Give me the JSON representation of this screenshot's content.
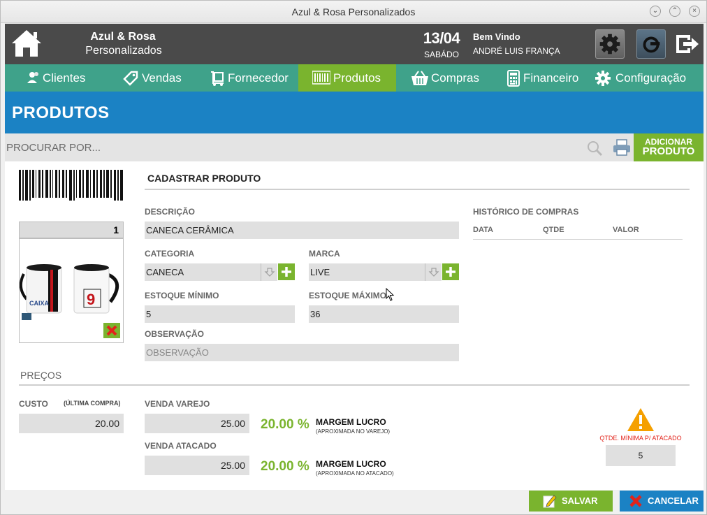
{
  "window": {
    "title": "Azul & Rosa Personalizados"
  },
  "header": {
    "brand_name": "Azul & Rosa",
    "brand_sub": "Personalizados",
    "date": "13/04",
    "weekday": "SABÁDO",
    "welcome": "Bem Vindo",
    "user": "ANDRÉ LUIS FRANÇA"
  },
  "nav": {
    "items": [
      {
        "label": "Clientes",
        "icon": "users-icon"
      },
      {
        "label": "Vendas",
        "icon": "tag-icon"
      },
      {
        "label": "Fornecedor",
        "icon": "supplier-icon"
      },
      {
        "label": "Produtos",
        "icon": "barcode-icon",
        "active": true
      },
      {
        "label": "Compras",
        "icon": "basket-icon"
      },
      {
        "label": "Financeiro",
        "icon": "calculator-icon"
      },
      {
        "label": "Configuração",
        "icon": "gear-icon"
      }
    ]
  },
  "page": {
    "title": "PRODUTOS"
  },
  "search": {
    "placeholder": "PROCURAR POR..."
  },
  "add_button": {
    "line1": "ADICIONAR",
    "line2": "PRODUTO"
  },
  "product": {
    "code": "1",
    "section_title": "CADASTRAR PRODUTO",
    "description_label": "DESCRIÇÃO",
    "description": "CANECA CERÂMICA",
    "category_label": "CATEGORIA",
    "category": "CANECA",
    "brand_label": "MARCA",
    "brand": "LIVE",
    "min_stock_label": "ESTOQUE MÍNIMO",
    "min_stock": "5",
    "max_stock_label": "ESTOQUE MÁXIMO",
    "max_stock": "36",
    "notes_label": "OBSERVAÇÃO",
    "notes_placeholder": "OBSERVAÇÃO"
  },
  "history": {
    "title": "HISTÓRICO DE COMPRAS",
    "columns": [
      "DATA",
      "QTDE",
      "VALOR"
    ]
  },
  "prices": {
    "title": "PREÇOS",
    "cost_label": "CUSTO",
    "cost_note": "(ÚLTIMA COMPRA)",
    "cost": "20.00",
    "retail_label": "VENDA VAREJO",
    "retail": "25.00",
    "retail_margin": "20.00 %",
    "retail_margin_title": "MARGEM LUCRO",
    "retail_margin_note": "(APROXIMADA NO VAREJO)",
    "wholesale_label": "VENDA ATACADO",
    "wholesale": "25.00",
    "wholesale_margin": "20.00 %",
    "wholesale_margin_title": "MARGEM LUCRO",
    "wholesale_margin_note": "(APROXIMADA NO ATACADO)",
    "min_wholesale_label": "QTDE. MÍNIMA P/ ATACADO",
    "min_wholesale": "5"
  },
  "footer": {
    "save": "SALVAR",
    "cancel": "CANCELAR"
  },
  "colors": {
    "header_bg": "#4a4a4a",
    "nav_bg": "#3fa28a",
    "accent_green": "#7ab42e",
    "accent_blue": "#1b82c4",
    "warning": "#f5a000"
  }
}
